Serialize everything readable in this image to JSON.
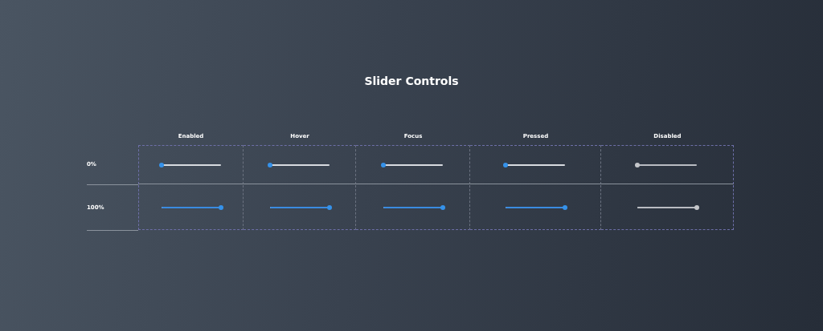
{
  "title": "Slider Controls",
  "columns": [
    {
      "label": "Enabled"
    },
    {
      "label": "Hover"
    },
    {
      "label": "Focus"
    },
    {
      "label": "Pressed"
    },
    {
      "label": "Disabled"
    }
  ],
  "rows": [
    {
      "label": "0%",
      "sliders": [
        {
          "level": 0,
          "disabled": false
        },
        {
          "level": 0,
          "disabled": false
        },
        {
          "level": 0,
          "disabled": false
        },
        {
          "level": 0,
          "disabled": false
        },
        {
          "level": 0,
          "disabled": true
        }
      ]
    },
    {
      "label": "100%",
      "sliders": [
        {
          "level": 1,
          "disabled": false
        },
        {
          "level": 1,
          "disabled": false
        },
        {
          "level": 1,
          "disabled": false
        },
        {
          "level": 1,
          "disabled": false
        },
        {
          "level": 1,
          "disabled": true
        }
      ]
    }
  ]
}
